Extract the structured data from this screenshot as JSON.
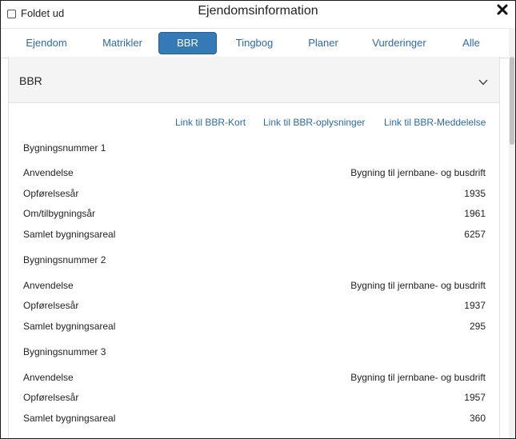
{
  "header": {
    "checkbox_label": "Foldet ud",
    "title": "Ejendomsinformation",
    "close_icon": "close-icon"
  },
  "tabs": [
    {
      "label": "Ejendom",
      "active": false
    },
    {
      "label": "Matrikler",
      "active": false
    },
    {
      "label": "BBR",
      "active": true
    },
    {
      "label": "Tingbog",
      "active": false
    },
    {
      "label": "Planer",
      "active": false
    },
    {
      "label": "Vurderinger",
      "active": false
    },
    {
      "label": "Alle",
      "active": false
    }
  ],
  "panel": {
    "title": "BBR",
    "expand_icon": "chevron-down-icon",
    "links": [
      "Link til BBR-Kort",
      "Link til BBR-oplysninger",
      "Link til BBR-Meddelelse"
    ],
    "buildings": [
      {
        "heading": "Bygningsnummer 1",
        "rows": [
          {
            "label": "Anvendelse",
            "value": "Bygning til jernbane- og busdrift"
          },
          {
            "label": "Opførelsesår",
            "value": "1935"
          },
          {
            "label": "Om/tilbygningsår",
            "value": "1961"
          },
          {
            "label": "Samlet bygningsareal",
            "value": "6257"
          }
        ]
      },
      {
        "heading": "Bygningsnummer 2",
        "rows": [
          {
            "label": "Anvendelse",
            "value": "Bygning til jernbane- og busdrift"
          },
          {
            "label": "Opførelsesår",
            "value": "1937"
          },
          {
            "label": "Samlet bygningsareal",
            "value": "295"
          }
        ]
      },
      {
        "heading": "Bygningsnummer 3",
        "rows": [
          {
            "label": "Anvendelse",
            "value": "Bygning til jernbane- og busdrift"
          },
          {
            "label": "Opførelsesår",
            "value": "1957"
          },
          {
            "label": "Samlet bygningsareal",
            "value": "360"
          }
        ]
      }
    ]
  },
  "colors": {
    "accent": "#337ab7",
    "link": "#2a6ab7",
    "panel_header_bg": "#f4f4f4"
  }
}
